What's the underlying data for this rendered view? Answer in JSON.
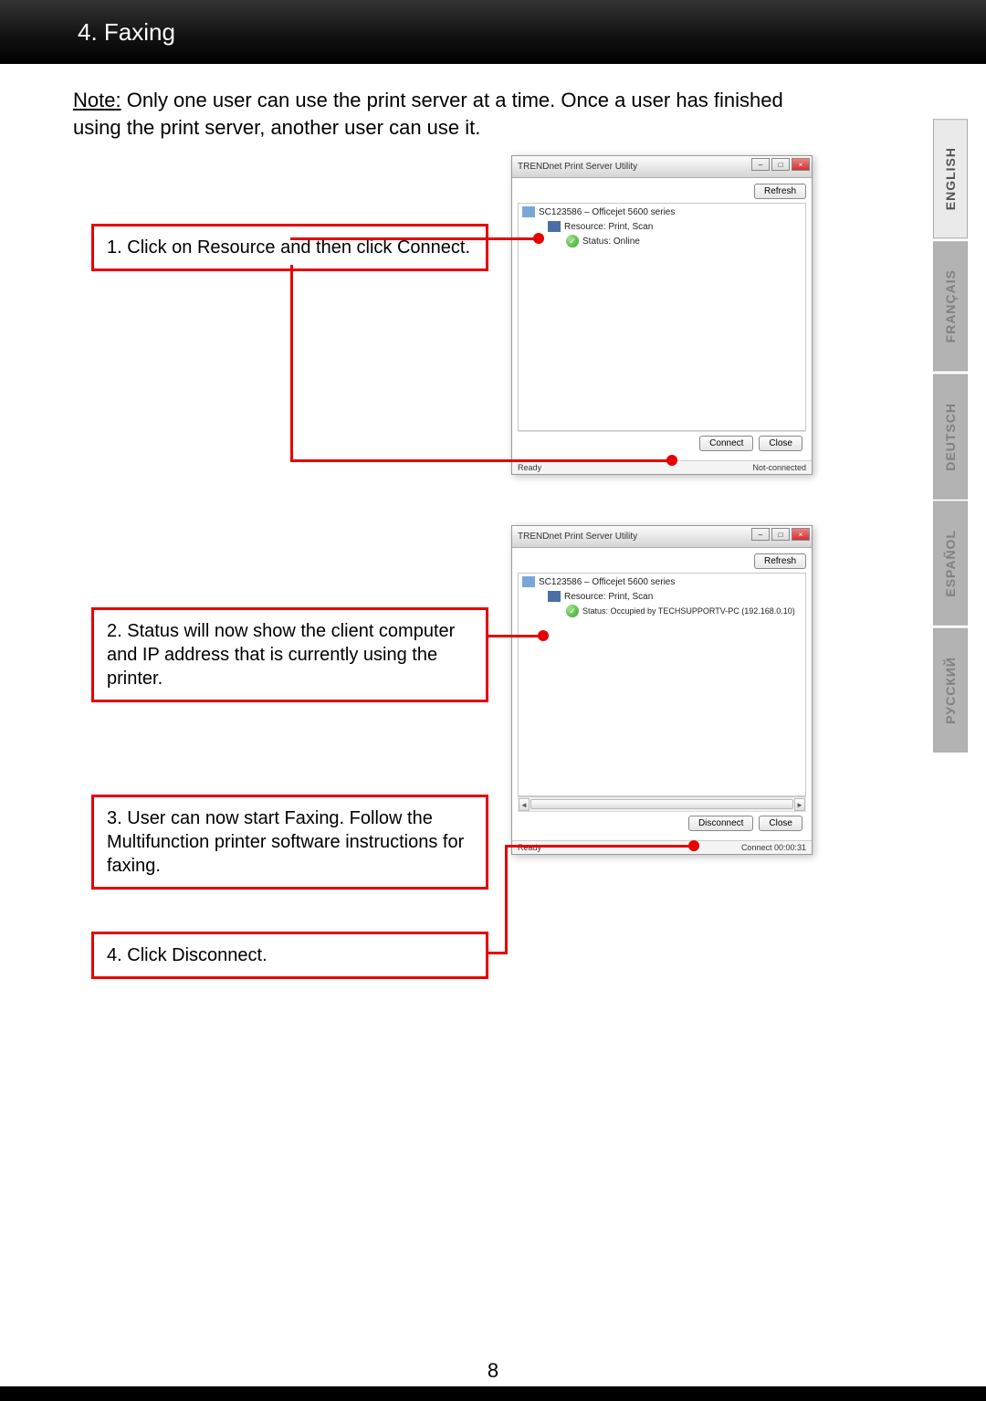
{
  "header": {
    "title": "4. Faxing"
  },
  "note": {
    "label": "Note:",
    "text": " Only one user can use the print server at a time.  Once a user has finished using the print server, another user can use it."
  },
  "callouts": {
    "c1_prefix": "1.",
    "c1_a": " Click on ",
    "c1_b": "Resource",
    "c1_c": " and then click ",
    "c1_d": "Connect",
    "c1_e": ".",
    "c2_prefix": "2.",
    "c2_text": " Status will now show the client computer and IP address that is currently using the printer.",
    "c3_prefix": "3.",
    "c3_text": " User can now start Faxing. Follow the Multifunction printer software instructions for faxing.",
    "c4_prefix": "4.",
    "c4_a": " Click ",
    "c4_b": "Disconnect",
    "c4_c": "."
  },
  "window1": {
    "title": "TRENDnet Print Server Utility",
    "refresh": "Refresh",
    "device": "SC123586 – Officejet 5600 series",
    "resource": "Resource: Print, Scan",
    "status": "Status: Online",
    "connect": "Connect",
    "close": "Close",
    "ready": "Ready",
    "conn": "Not-connected"
  },
  "window2": {
    "title": "TRENDnet Print Server Utility",
    "refresh": "Refresh",
    "device": "SC123586 – Officejet 5600 series",
    "resource": "Resource: Print, Scan",
    "status": "Status: Occupied by TECHSUPPORTV-PC (192.168.0.10)",
    "disconnect": "Disconnect",
    "close": "Close",
    "ready": "Ready",
    "conn": "Connect 00:00:31"
  },
  "langs": {
    "english": "ENGLISH",
    "francais": "FRANÇAIS",
    "deutsch": "DEUTSCH",
    "espanol": "ESPAÑOL",
    "russian": "РУССКИЙ"
  },
  "page_number": "8"
}
